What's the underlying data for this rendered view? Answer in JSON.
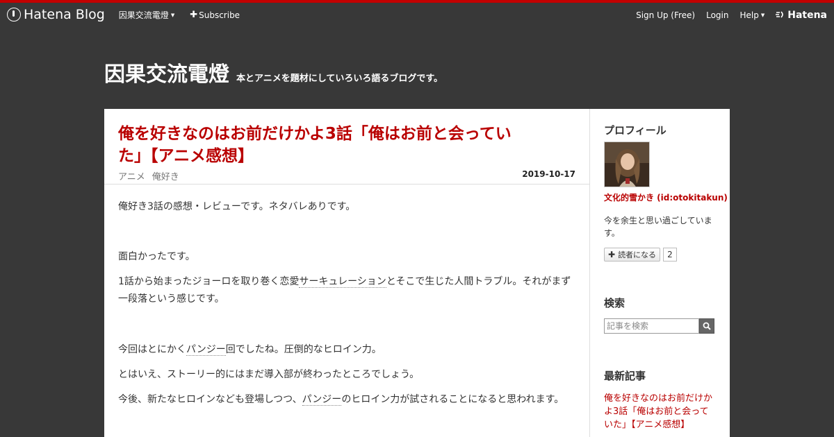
{
  "global_header": {
    "logo_text": "Hatena Blog",
    "blog_menu": "因果交流電燈",
    "subscribe": "Subscribe",
    "signup": "Sign Up (Free)",
    "login": "Login",
    "help": "Help",
    "hatena_logo": "Hatena"
  },
  "blog": {
    "title": "因果交流電燈",
    "description": "本とアニメを題材にしていろいろ語るブログです。"
  },
  "entry": {
    "title": "俺を好きなのはお前だけかよ3話「俺はお前と会っていた」【アニメ感想】",
    "categories": [
      "アニメ",
      "俺好き"
    ],
    "date": "2019-10-17",
    "paragraphs": {
      "p1": "俺好き3話の感想・レビューです。ネタバレありです。",
      "p2": "面白かったです。",
      "p3_a": "1話から始まったジョーロを取り巻く恋愛",
      "p3_kw": "サーキュレーション",
      "p3_b": "とそこで生じた人間トラブル。それがまず一段落という感じです。",
      "p4_a": "今回はとにかく",
      "p4_kw": "パンジー",
      "p4_b": "回でしたね。圧倒的なヒロイン力。",
      "p5": "とはいえ、ストーリー的にはまだ導入部が終わったところでしょう。",
      "p6_a": "今後、新たなヒロインなども登場しつつ、",
      "p6_kw": "パンジー",
      "p6_b": "のヒロイン力が試されることになると思われます。"
    }
  },
  "sidebar": {
    "profile_heading": "プロフィール",
    "profile_name": "文化的雪かき (id:otokitakun)",
    "profile_desc": "今を余生と思い過ごしています。",
    "subscribe_label": "読者になる",
    "subscriber_count": "2",
    "search_heading": "検索",
    "search_placeholder": "記事を検索",
    "recent_heading": "最新記事",
    "recent_items": [
      "俺を好きなのはお前だけかよ3話「俺はお前と会っていた」【アニメ感想】"
    ]
  },
  "colors": {
    "accent": "#b90000",
    "background": "#383838",
    "top_stripe": "#c20000"
  }
}
